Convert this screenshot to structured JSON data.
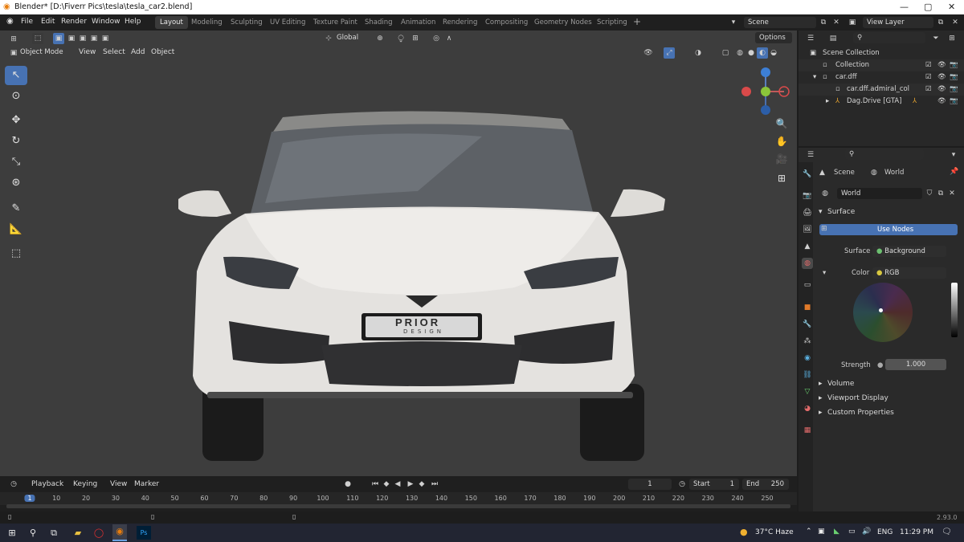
{
  "window": {
    "title": "Blender* [D:\\Fiverr Pics\\tesla\\tesla_car2.blend]"
  },
  "menu": {
    "items": [
      "File",
      "Edit",
      "Render",
      "Window",
      "Help"
    ]
  },
  "workspaces": [
    "Layout",
    "Modeling",
    "Sculpting",
    "UV Editing",
    "Texture Paint",
    "Shading",
    "Animation",
    "Rendering",
    "Compositing",
    "Geometry Nodes",
    "Scripting"
  ],
  "scene": {
    "name": "Scene",
    "view_layer": "View Layer"
  },
  "viewport": {
    "transform_orientation": "Global",
    "options_label": "Options",
    "mode": "Object Mode",
    "header_menus": [
      "View",
      "Select",
      "Add",
      "Object"
    ],
    "gizmo": {
      "x": "X",
      "y": "Y",
      "z": "Z"
    },
    "plate": {
      "line1": "PRIOR",
      "line2": "DESIGN"
    }
  },
  "timeline": {
    "menus": [
      "Playback",
      "Keying",
      "View",
      "Marker"
    ],
    "current_frame": "1",
    "start_label": "Start",
    "start": "1",
    "end_label": "End",
    "end": "250",
    "ticks": [
      "1",
      "10",
      "20",
      "30",
      "40",
      "50",
      "60",
      "70",
      "80",
      "90",
      "100",
      "110",
      "120",
      "130",
      "140",
      "150",
      "160",
      "170",
      "180",
      "190",
      "200",
      "210",
      "220",
      "230",
      "240",
      "250"
    ]
  },
  "outliner": {
    "root": "Scene Collection",
    "items": [
      {
        "label": "Collection",
        "indent": 1
      },
      {
        "label": "car.dff",
        "indent": 1
      },
      {
        "label": "car.dff.admiral_col",
        "indent": 2
      },
      {
        "label": "Dag.Drive [GTA]",
        "indent": 2
      }
    ]
  },
  "properties": {
    "breadcrumb_scene": "Scene",
    "breadcrumb_world": "World",
    "world_name": "World",
    "surface_section": "Surface",
    "use_nodes": "Use Nodes",
    "surface_label": "Surface",
    "surface_value": "Background",
    "color_label": "Color",
    "color_value": "RGB",
    "strength_label": "Strength",
    "strength_value": "1.000",
    "sections": [
      "Volume",
      "Viewport Display",
      "Custom Properties"
    ]
  },
  "statusbar": {
    "version": "2.93.0"
  },
  "taskbar": {
    "weather": "37°C Haze",
    "lang": "ENG",
    "time": "11:29 PM"
  },
  "colors": {
    "accent": "#4772b3",
    "viewport_bg": "#3d3d3d",
    "panel_bg": "#2a2a2a"
  }
}
